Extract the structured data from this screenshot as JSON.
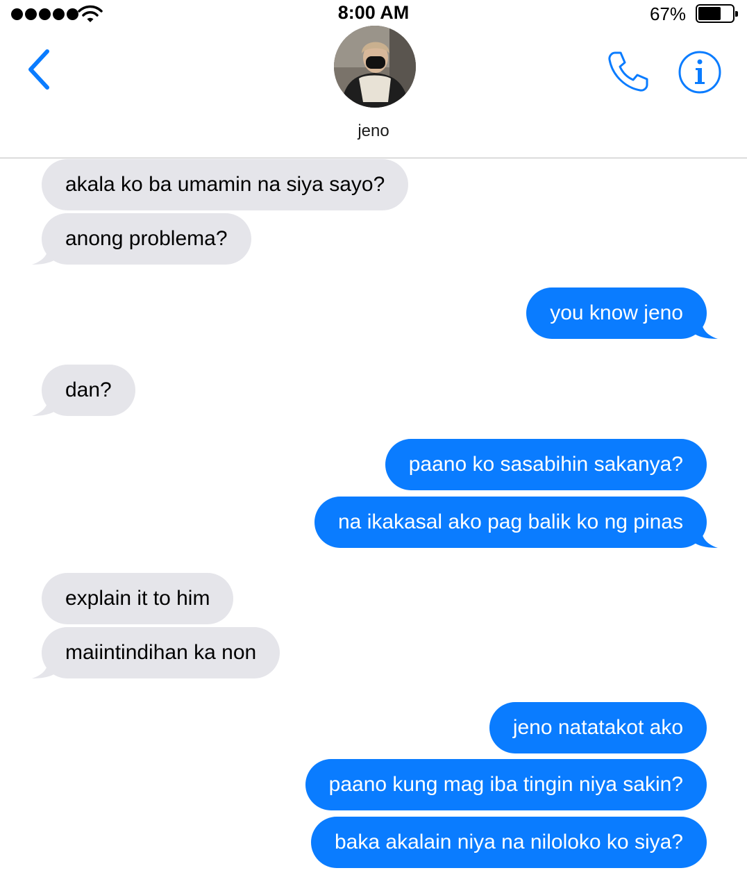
{
  "status_bar": {
    "time": "8:00 AM",
    "battery_percent": "67%",
    "battery_level": 0.67,
    "signal_bars": 5
  },
  "header": {
    "contact_name": "jeno",
    "back_icon": "chevron-left-icon",
    "call_icon": "phone-icon",
    "info_icon": "info-icon"
  },
  "colors": {
    "accent": "#0a7cff",
    "incoming_bubble": "#e5e5ea",
    "outgoing_bubble": "#0a7cff"
  },
  "messages": [
    {
      "from": "them",
      "text": "akala ko ba umamin na siya sayo?"
    },
    {
      "from": "them",
      "text": "anong problema?"
    },
    {
      "from": "me",
      "text": "you know jeno"
    },
    {
      "from": "them",
      "text": "dan?"
    },
    {
      "from": "me",
      "text": "paano ko sasabihin sakanya?"
    },
    {
      "from": "me",
      "text": "na ikakasal ako pag balik ko ng pinas"
    },
    {
      "from": "them",
      "text": "explain it to him"
    },
    {
      "from": "them",
      "text": "maiintindihan ka non"
    },
    {
      "from": "me",
      "text": "jeno natatakot ako"
    },
    {
      "from": "me",
      "text": "paano kung mag iba tingin niya sakin?"
    },
    {
      "from": "me",
      "text": "baka akalain niya na niloloko ko siya?"
    }
  ]
}
